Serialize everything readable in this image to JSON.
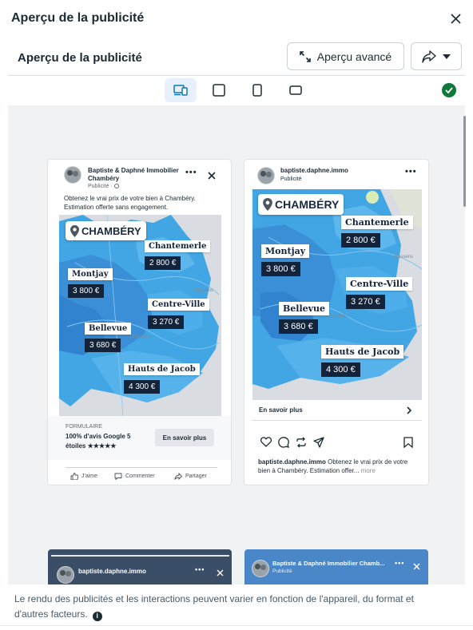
{
  "dialog": {
    "title": "Aperçu de la publicité",
    "section_title": "Aperçu de la publicité",
    "advanced_button": "Aperçu avancé",
    "footnote": "Le rendu des publicités et les interactions peuvent varier en fonction de l'appareil, du format et d'autres facteurs."
  },
  "format_bar": {
    "items": [
      "devices-icon",
      "square-icon",
      "portrait-icon",
      "landscape-icon"
    ],
    "active_index": 0,
    "status": "check-icon"
  },
  "facebook_ad": {
    "page_name": "Baptiste & Daphné Immobilier Chambéry",
    "sponsored": "Publicité · ",
    "primary_text": "Obtenez le vrai prix de votre bien à Chambéry. Estimation offerte sans engagement.",
    "form_label": "FORMULAIRE",
    "headline": "100% d'avis Google 5 étoiles ★★★★★",
    "cta": "En savoir plus",
    "actions": [
      "J'aime",
      "Commenter",
      "Partager"
    ]
  },
  "instagram_ad": {
    "username": "baptiste.daphne.immo",
    "sponsored": "Publicité",
    "cta": "En savoir plus",
    "caption_user": "baptiste.daphne.immo",
    "caption_text": " Obtenez le vrai prix de votre bien à Chambéry. Estimation offer...",
    "more": " more"
  },
  "map": {
    "city": "CHAMBÉRY",
    "areas": [
      {
        "name": "Chantemerle",
        "price": "2 800 €"
      },
      {
        "name": "Montjay",
        "price": "3 800 €"
      },
      {
        "name": "Centre-Ville",
        "price": "3 270 €"
      },
      {
        "name": "Bellevue",
        "price": "3 680 €"
      },
      {
        "name": "Hauts de Jacob",
        "price": "4 300 €"
      }
    ],
    "towns": {
      "bassens": "Bassens",
      "chambery": "Chambéry",
      "jacob": "Jacob-Bellecombette"
    }
  },
  "story_previews": {
    "left_username": "baptiste.daphne.immo",
    "right_page": "Baptiste & Daphné Immobilier Chamb...",
    "right_sponsored": "Publicité"
  },
  "colors": {
    "accent": "#0a78be",
    "navy": "#13233a",
    "success": "#0d7a39",
    "map_blue": "#3aa3e3"
  }
}
